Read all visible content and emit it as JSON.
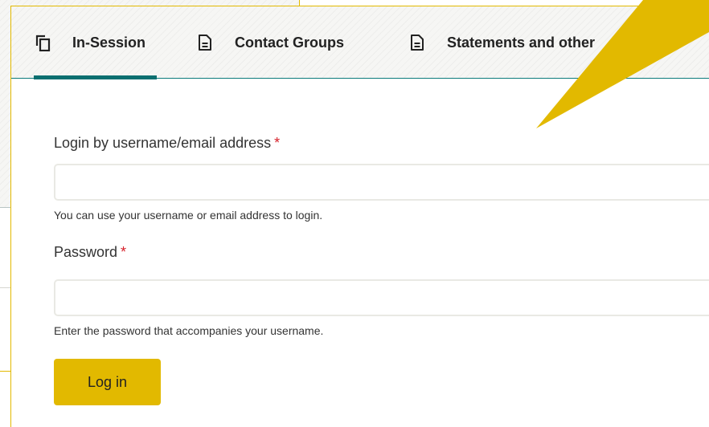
{
  "tabs": [
    {
      "label": "In-Session",
      "icon": "copy-icon",
      "active": true
    },
    {
      "label": "Contact Groups",
      "icon": "document-icon",
      "active": false
    },
    {
      "label": "Statements and other",
      "icon": "document-icon",
      "active": false
    }
  ],
  "form": {
    "username": {
      "label": "Login by username/email address",
      "required_mark": "*",
      "value": "",
      "help": "You can use your username or email address to login."
    },
    "password": {
      "label": "Password",
      "required_mark": "*",
      "value": "",
      "help": "Enter the password that accompanies your username."
    },
    "submit_label": "Log in"
  },
  "colors": {
    "accent": "#e2b900",
    "teal": "#0b6f70",
    "required": "#d6202a"
  }
}
